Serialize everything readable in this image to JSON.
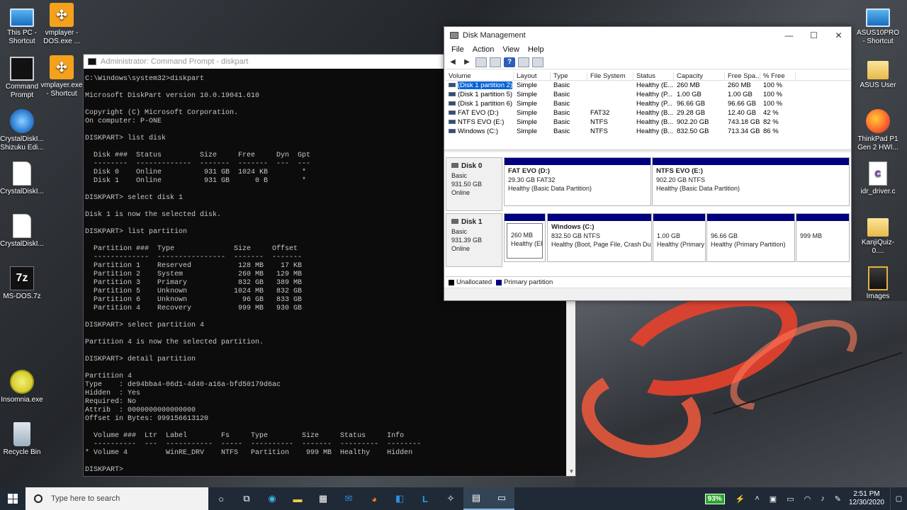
{
  "desktop": {
    "left_icons": [
      {
        "label": "This PC - Shortcut"
      },
      {
        "label": "vmplayer - DOS.exe ..."
      },
      {
        "label": "Command Prompt"
      },
      {
        "label": "vmplayer.exe - Shortcut"
      },
      {
        "label": "CrystalDiskI... Shizuku Edi..."
      },
      {
        "label": "CrystalDiskI..."
      },
      {
        "label": "CrystalDiskI..."
      },
      {
        "label": "MS-DOS.7z"
      },
      {
        "label": "Insomnia.exe"
      },
      {
        "label": "Recycle Bin"
      }
    ],
    "right_icons": [
      {
        "label": "ASUS10PRO - Shortcut"
      },
      {
        "label": "ASUS User"
      },
      {
        "label": "ThinkPad P1 Gen 2 HWI..."
      },
      {
        "label": "idr_driver.c"
      },
      {
        "label": "KanjiQuiz-0...."
      },
      {
        "label": "Images"
      }
    ]
  },
  "cmd": {
    "title": "Administrator: Command Prompt - diskpart",
    "lines": [
      "C:\\Windows\\system32>diskpart",
      "",
      "Microsoft DiskPart version 10.0.19041.610",
      "",
      "Copyright (C) Microsoft Corporation.",
      "On computer: P-ONE",
      "",
      "DISKPART> list disk",
      "",
      "  Disk ###  Status         Size     Free     Dyn  Gpt",
      "  --------  -------------  -------  -------  ---  ---",
      "  Disk 0    Online          931 GB  1024 KB        *",
      "  Disk 1    Online          931 GB      0 B        *",
      "",
      "DISKPART> select disk 1",
      "",
      "Disk 1 is now the selected disk.",
      "",
      "DISKPART> list partition",
      "",
      "  Partition ###  Type              Size     Offset",
      "  -------------  ----------------  -------  -------",
      "  Partition 1    Reserved           128 MB    17 KB",
      "  Partition 2    System             260 MB   129 MB",
      "  Partition 3    Primary            832 GB   389 MB",
      "  Partition 5    Unknown           1024 MB   832 GB",
      "  Partition 6    Unknown             96 GB   833 GB",
      "  Partition 4    Recovery           999 MB   930 GB",
      "",
      "DISKPART> select partition 4",
      "",
      "Partition 4 is now the selected partition.",
      "",
      "DISKPART> detail partition",
      "",
      "Partition 4",
      "Type    : de94bba4-06d1-4d40-a16a-bfd50179d6ac",
      "Hidden  : Yes",
      "Required: No",
      "Attrib  : 0000000000000000",
      "Offset in Bytes: 999156613120",
      "",
      "  Volume ###  Ltr  Label        Fs     Type        Size     Status     Info",
      "  ----------  ---  -----------  -----  ----------  -------  ---------  --------",
      "* Volume 4         WinRE_DRV    NTFS   Partition    999 MB  Healthy    Hidden",
      "",
      "DISKPART> "
    ]
  },
  "diskmgmt": {
    "title": "Disk Management",
    "window_buttons": {
      "minimize": "—",
      "maximize": "☐",
      "close": "✕"
    },
    "menu": [
      "File",
      "Action",
      "View",
      "Help"
    ],
    "columns": [
      "Volume",
      "Layout",
      "Type",
      "File System",
      "Status",
      "Capacity",
      "Free Spa...",
      "% Free"
    ],
    "volumes": [
      {
        "volume": "(Disk 1 partition 2)",
        "layout": "Simple",
        "type": "Basic",
        "fs": "",
        "status": "Healthy (E...",
        "capacity": "260 MB",
        "free": "260 MB",
        "pct": "100 %"
      },
      {
        "volume": "(Disk 1 partition 5)",
        "layout": "Simple",
        "type": "Basic",
        "fs": "",
        "status": "Healthy (P...",
        "capacity": "1.00 GB",
        "free": "1.00 GB",
        "pct": "100 %"
      },
      {
        "volume": "(Disk 1 partition 6)",
        "layout": "Simple",
        "type": "Basic",
        "fs": "",
        "status": "Healthy (P...",
        "capacity": "96.66 GB",
        "free": "96.66 GB",
        "pct": "100 %"
      },
      {
        "volume": "FAT EVO (D:)",
        "layout": "Simple",
        "type": "Basic",
        "fs": "FAT32",
        "status": "Healthy (B...",
        "capacity": "29.28 GB",
        "free": "12.40 GB",
        "pct": "42 %"
      },
      {
        "volume": "NTFS EVO (E:)",
        "layout": "Simple",
        "type": "Basic",
        "fs": "NTFS",
        "status": "Healthy (B...",
        "capacity": "902.20 GB",
        "free": "743.18 GB",
        "pct": "82 %"
      },
      {
        "volume": "Windows (C:)",
        "layout": "Simple",
        "type": "Basic",
        "fs": "NTFS",
        "status": "Healthy (B...",
        "capacity": "832.50 GB",
        "free": "713.34 GB",
        "pct": "86 %"
      }
    ],
    "disks": [
      {
        "name": "Disk 0",
        "kind": "Basic",
        "size": "931.50 GB",
        "state": "Online",
        "partitions": [
          {
            "name": "FAT EVO  (D:)",
            "size": "29.30 GB FAT32",
            "status": "Healthy (Basic Data Partition)"
          },
          {
            "name": "NTFS EVO  (E:)",
            "size": "902.20 GB NTFS",
            "status": "Healthy (Basic Data Partition)"
          }
        ]
      },
      {
        "name": "Disk 1",
        "kind": "Basic",
        "size": "931.39 GB",
        "state": "Online",
        "partitions": [
          {
            "name": "",
            "size": "260 MB",
            "status": "Healthy (EFI"
          },
          {
            "name": "Windows  (C:)",
            "size": "832.50 GB NTFS",
            "status": "Healthy (Boot, Page File, Crash Dur"
          },
          {
            "name": "",
            "size": "1.00 GB",
            "status": "Healthy (Primary"
          },
          {
            "name": "",
            "size": "96.66 GB",
            "status": "Healthy (Primary Partition)"
          },
          {
            "name": "",
            "size": "999 MB",
            "status": ""
          }
        ]
      }
    ],
    "legend": [
      {
        "label": "Unallocated",
        "color": "#000000"
      },
      {
        "label": "Primary partition",
        "color": "#000080"
      }
    ]
  },
  "taskbar": {
    "search_placeholder": "Type here to search",
    "battery": "93%",
    "time": "2:51 PM",
    "date": "12/30/2020"
  }
}
